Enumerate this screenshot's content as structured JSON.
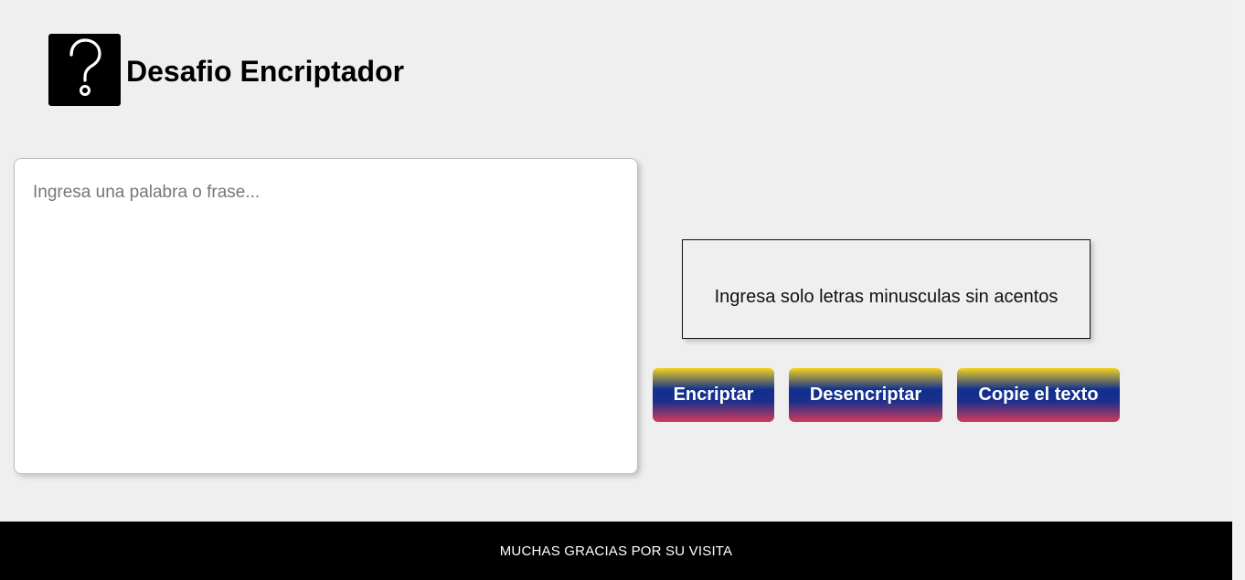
{
  "header": {
    "title": "Desafio Encriptador",
    "logo_icon": "question-mark-icon"
  },
  "input": {
    "placeholder": "Ingresa una palabra o frase...",
    "value": ""
  },
  "notice": {
    "text": "Ingresa solo letras minusculas sin acentos"
  },
  "buttons": {
    "encrypt_label": "Encriptar",
    "decrypt_label": "Desencriptar",
    "copy_label": "Copie el texto"
  },
  "footer": {
    "text": "MUCHAS GRACIAS POR SU VISITA"
  },
  "colors": {
    "background": "#efefef",
    "footer": "#000000",
    "button_gradient": [
      "#f4d21e",
      "#0f2f8f",
      "#d33a5a"
    ]
  }
}
